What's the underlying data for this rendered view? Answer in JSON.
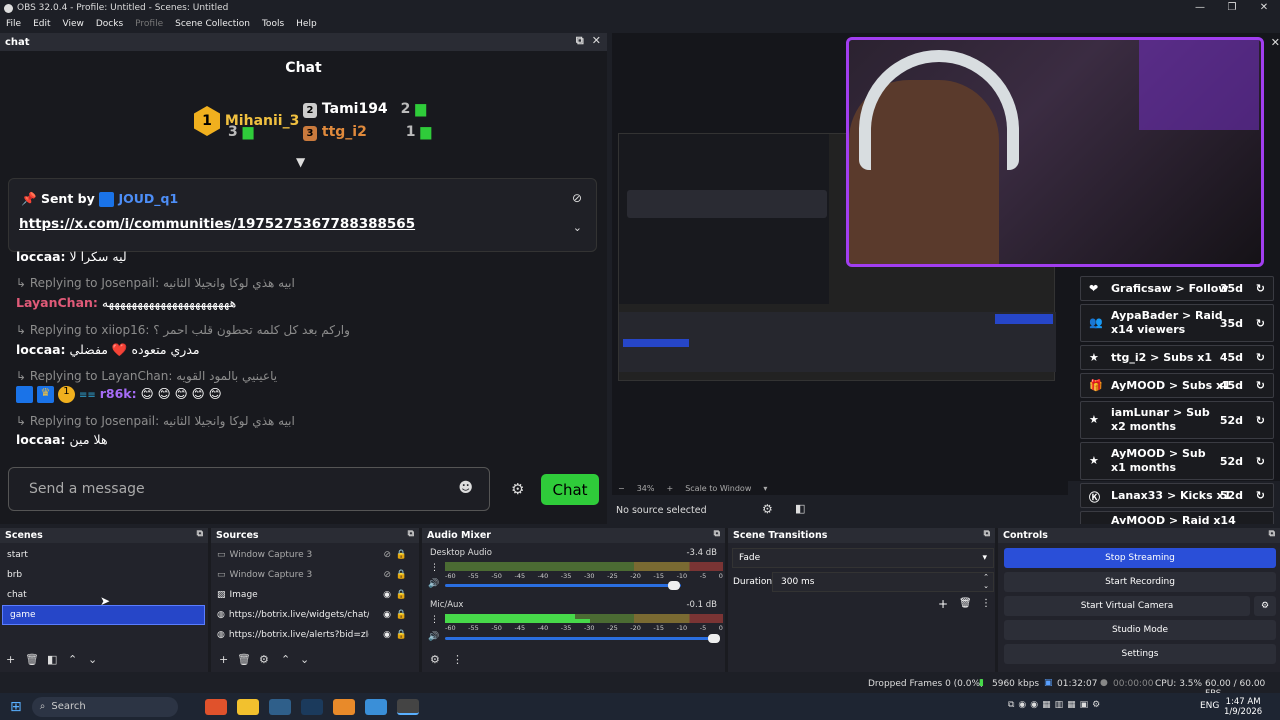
{
  "titlebar": {
    "title": "OBS 32.0.4 - Profile: Untitled - Scenes: Untitled"
  },
  "menu": [
    "File",
    "Edit",
    "View",
    "Docks",
    "Profile",
    "Scene Collection",
    "Tools",
    "Help"
  ],
  "chat_dock": {
    "label": "chat",
    "title": "Chat",
    "leaders": [
      {
        "rank": "1",
        "name": "Mihanii_3",
        "count": "3"
      },
      {
        "rank": "2",
        "name": "Tami194",
        "count": "2"
      },
      {
        "rank": "3",
        "name": "ttg_i2",
        "count": "1"
      }
    ],
    "pinned": {
      "sent_by_label": "Sent by",
      "user": "JOUD_q1",
      "link": "https://x.com/i/communities/1975275367788388565"
    },
    "messages": [
      {
        "user": "loccaa:",
        "text": "ليه سكرا لا"
      },
      {
        "reply": "Replying to Josenpail: ابيه هذي لوكا وانجيلا الثانيه"
      },
      {
        "user": "LayanChan:",
        "text": "ههههههههههههههههههههههه"
      },
      {
        "reply": "Replying to xiiop16: واركم بعد كل كلمه تحطون قلب احمر ؟"
      },
      {
        "user": "loccaa:",
        "text": "مدري متعوده ❤️ مفضلي"
      },
      {
        "reply": "Replying to LayanChan: ياعينيي بالمود القويه"
      },
      {
        "user": "r86k:",
        "text": "😊 😊 😊 😊 😊"
      },
      {
        "reply": "Replying to Josenpail: ابيه هذي لوكا وانجيلا الثانيه"
      },
      {
        "user": "loccaa:",
        "text": "هلا مين"
      }
    ],
    "input_placeholder": "Send a message",
    "chat_button": "Chat"
  },
  "alerts": [
    {
      "user": "Graficsaw",
      "action": "> Follow",
      "time": "35d"
    },
    {
      "user": "AypaBader",
      "action": "> Raid x14 viewers",
      "time": "35d"
    },
    {
      "user": "ttg_i2",
      "action": "> Subs x1",
      "time": "45d"
    },
    {
      "user": "AyMOOD",
      "action": "> Subs x1",
      "time": "45d"
    },
    {
      "user": "iamLunar",
      "action": "> Sub x2 months",
      "time": "52d"
    },
    {
      "user": "AyMOOD",
      "action": "> Sub x1 months",
      "time": "52d"
    },
    {
      "user": "Lanax33",
      "action": "> Kicks x1",
      "time": "52d"
    },
    {
      "user": "AyMOOD",
      "action": "> Raid x14",
      "time": ""
    }
  ],
  "preview": {
    "zoom": "34%",
    "scale": "Scale to Window",
    "no_source": "No source selected"
  },
  "scenes": {
    "title": "Scenes",
    "items": [
      "start",
      "brb",
      "chat",
      "game"
    ],
    "selected_index": 3
  },
  "sources": {
    "title": "Sources",
    "items": [
      "Window Capture 3",
      "Window Capture 3",
      "Image",
      "https://botrix.live/widgets/chat/?bi",
      "https://botrix.live/alerts?bid=zIgUa"
    ]
  },
  "mixer": {
    "title": "Audio Mixer",
    "channels": [
      {
        "name": "Desktop Audio",
        "db": "-3.4 dB",
        "level": 0.0
      },
      {
        "name": "Mic/Aux",
        "db": "-0.1 dB",
        "level": 0.5
      }
    ],
    "scale": [
      "-60",
      "-55",
      "-50",
      "-45",
      "-40",
      "-35",
      "-30",
      "-25",
      "-20",
      "-15",
      "-10",
      "-5",
      "0"
    ]
  },
  "transitions": {
    "title": "Scene Transitions",
    "type": "Fade",
    "duration_label": "Duration",
    "duration": "300 ms"
  },
  "controls": {
    "title": "Controls",
    "buttons": [
      "Stop Streaming",
      "Start Recording",
      "Start Virtual Camera",
      "Studio Mode",
      "Settings"
    ]
  },
  "status": {
    "dropped": "Dropped Frames 0 (0.0%)",
    "kbps": "5960 kbps",
    "stream_time": "01:32:07",
    "rec_time": "00:00:00",
    "cpu": "CPU: 3.5%",
    "fps": "60.00 / 60.00 FPS"
  },
  "taskbar": {
    "search": "Search",
    "lang": "ENG",
    "time": "1:47 AM",
    "date": "1/9/2026"
  }
}
